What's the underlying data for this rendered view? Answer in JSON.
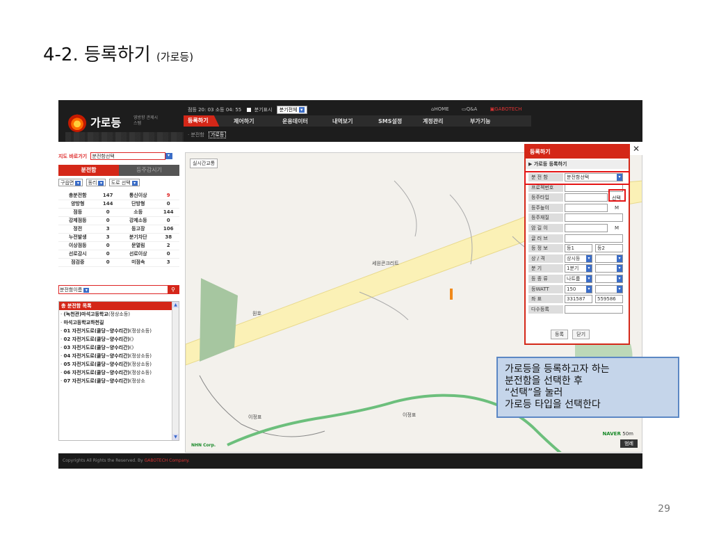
{
  "slide": {
    "title": "4-2. 등록하기",
    "title_sub": "(가로등)",
    "page_number": "29"
  },
  "app": {
    "logo": "가로등",
    "logo_sub": "영방향 관제시스템",
    "status": "점등 20: 03 소등 04: 55",
    "branch_toggle_label": "분기표시",
    "branch_select": "분기전체",
    "top_links": [
      "HOME",
      "Q&A",
      "GABOTECH"
    ],
    "menu": [
      "등록하기",
      "제어하기",
      "운용데이터",
      "내역보기",
      "SMS설정",
      "계정관리",
      "부가기능"
    ],
    "submenu": [
      "분전함",
      "가로등"
    ],
    "footer": "Copyrights All Rights the Reserved. By",
    "footer_brand": "GABOTECH Company."
  },
  "sidebar": {
    "quick_label": "지도 바로가기",
    "quick_value": "분전함선택",
    "tabs": [
      "분전함",
      "등주감시기"
    ],
    "filters": [
      "구읍면",
      "동리",
      "도로 선택"
    ],
    "stats": [
      [
        "총분전함",
        "147",
        "통신이상",
        "9"
      ],
      [
        "양방형",
        "144",
        "단방형",
        "0"
      ],
      [
        "점등",
        "0",
        "소등",
        "144"
      ],
      [
        "강제점등",
        "0",
        "강제소등",
        "0"
      ],
      [
        "정전",
        "3",
        "등고장",
        "106"
      ],
      [
        "누전발생",
        "3",
        "분기차단",
        "38"
      ],
      [
        "이상점등",
        "0",
        "문열림",
        "2"
      ],
      [
        "선로감시",
        "0",
        "선로이상",
        "0"
      ],
      [
        "점검중",
        "0",
        "미점속",
        "3"
      ]
    ],
    "search_select": "분전함이름",
    "list_title": "총 분전함 목록",
    "list": [
      {
        "name": "(녹천관)마석고등학교",
        "note": "(정상소등)"
      },
      {
        "name": "마석고등학교하천길",
        "note": ""
      },
      {
        "name": "01 자전거도로(쿨당~양수리간)",
        "note": "(정상소등)"
      },
      {
        "name": "02 자전거도로(쿨당~양수리간)",
        "note": "()"
      },
      {
        "name": "03 자전거도로(쿨당~양수리간)",
        "note": "()"
      },
      {
        "name": "04 자전거도로(쿨당~양수리간)",
        "note": "(정상소등)"
      },
      {
        "name": "05 자전거도로(쿨당~양수리간)",
        "note": "(정상소등)"
      },
      {
        "name": "06 자전거도로(쿨당~양수리간)",
        "note": "(정상소등)"
      },
      {
        "name": "07 자전거도로(쿨당~양수리간)",
        "note": "(정상소"
      }
    ]
  },
  "map": {
    "traffic_button": "실시간교통",
    "labels": [
      "세원콘크리트",
      "이정표",
      "이정표",
      "원호"
    ],
    "brand": "NHN Corp.",
    "naver": "NAVER",
    "scale": "50m",
    "range_button": "범례"
  },
  "dialog": {
    "title": "등록하기",
    "close": "✕",
    "section": "▶ 가로등 등록하기",
    "rows": [
      {
        "k": "분 전 함",
        "v": "분전함선택"
      },
      {
        "k": "프로젝번호",
        "v": ""
      },
      {
        "k": "등주타입",
        "v": "",
        "btn": "선택"
      },
      {
        "k": "등주높이",
        "v": "",
        "unit": "M"
      },
      {
        "k": "등주재질",
        "v": ""
      },
      {
        "k": "암 길 이",
        "v": "",
        "unit": "M"
      },
      {
        "k": "글 러 브",
        "v": ""
      },
      {
        "k": "등 정 보",
        "v": "등1",
        "v2": "등2"
      },
      {
        "k": "상 / 격",
        "v": "상시등"
      },
      {
        "k": "분   기",
        "v": "1분기"
      },
      {
        "k": "등 종 류",
        "v": "나트륨"
      },
      {
        "k": "등WATT",
        "v": "150"
      },
      {
        "k": "좌   표",
        "v": "331587",
        "v2": "559586"
      },
      {
        "k": "다수등록",
        "v": ""
      }
    ],
    "buttons": [
      "등록",
      "닫기"
    ]
  },
  "callout": {
    "lines": [
      "가로등을 등록하고자 하는",
      "분전함을 선택한 후",
      "“선택”을 눌러",
      "가로등 타입을 선택한다"
    ]
  }
}
